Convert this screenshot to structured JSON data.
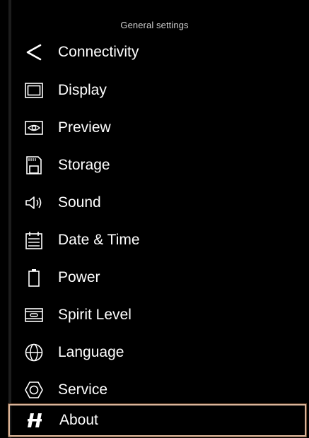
{
  "header": {
    "title": "General settings"
  },
  "menu": {
    "items": [
      {
        "label": "Connectivity",
        "icon": "share-icon"
      },
      {
        "label": "Display",
        "icon": "display-icon"
      },
      {
        "label": "Preview",
        "icon": "preview-eye-icon"
      },
      {
        "label": "Storage",
        "icon": "sd-card-icon"
      },
      {
        "label": "Sound",
        "icon": "speaker-icon"
      },
      {
        "label": "Date & Time",
        "icon": "calendar-icon"
      },
      {
        "label": "Power",
        "icon": "battery-icon"
      },
      {
        "label": "Spirit Level",
        "icon": "spirit-level-icon"
      },
      {
        "label": "Language",
        "icon": "globe-icon"
      },
      {
        "label": "Service",
        "icon": "hexagon-nut-icon"
      },
      {
        "label": "About",
        "icon": "hasselblad-h-icon",
        "selected": true
      }
    ]
  },
  "colors": {
    "background": "#000000",
    "text": "#ffffff",
    "selection_border": "#d9b49a"
  }
}
